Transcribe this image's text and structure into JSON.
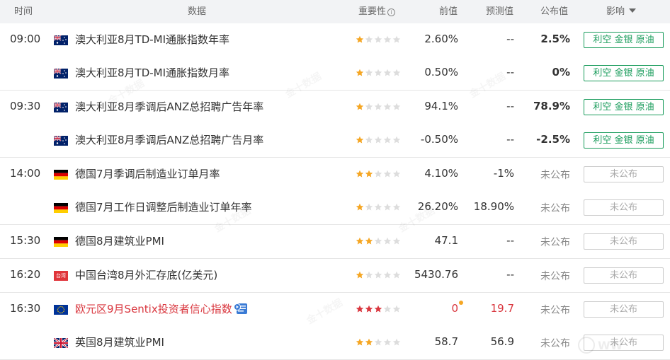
{
  "header": {
    "time": "时间",
    "data": "数据",
    "importance": "重要性",
    "info_icon": "i",
    "previous": "前值",
    "forecast": "预测值",
    "actual": "公布值",
    "effect": "影响"
  },
  "colors": {
    "star_on": "#f5a623",
    "star_red": "#d9363e",
    "star_off": "#dddddd",
    "effect_green": "#1a9c5c",
    "highlight_red": "#d9363e"
  },
  "groups": [
    {
      "time": "09:00",
      "rows": [
        {
          "flag": "australia-flag",
          "name": "澳大利亚8月TD-MI通胀指数年率",
          "stars": 1,
          "previous": "2.60%",
          "forecast": "--",
          "actual": "2.5%",
          "effect": "利空 金银 原油"
        },
        {
          "flag": "australia-flag",
          "name": "澳大利亚8月TD-MI通胀指数月率",
          "stars": 1,
          "previous": "0.50%",
          "forecast": "--",
          "actual": "0%",
          "effect": "利空 金银 原油"
        }
      ]
    },
    {
      "time": "09:30",
      "rows": [
        {
          "flag": "australia-flag",
          "name": "澳大利亚8月季调后ANZ总招聘广告年率",
          "stars": 1,
          "previous": "94.1%",
          "forecast": "--",
          "actual": "78.9%",
          "effect": "利空 金银 原油"
        },
        {
          "flag": "australia-flag",
          "name": "澳大利亚8月季调后ANZ总招聘广告月率",
          "stars": 1,
          "previous": "-0.50%",
          "forecast": "--",
          "actual": "-2.5%",
          "effect": "利空 金银 原油"
        }
      ]
    },
    {
      "time": "14:00",
      "rows": [
        {
          "flag": "germany-flag",
          "name": "德国7月季调后制造业订单月率",
          "stars": 2,
          "previous": "4.10%",
          "forecast": "-1%",
          "actual": "未公布",
          "effect": "未公布"
        },
        {
          "flag": "germany-flag",
          "name": "德国7月工作日调整后制造业订单年率",
          "stars": 1,
          "previous": "26.20%",
          "forecast": "18.90%",
          "actual": "未公布",
          "effect": "未公布"
        }
      ]
    },
    {
      "time": "15:30",
      "rows": [
        {
          "flag": "germany-flag",
          "name": "德国8月建筑业PMI",
          "stars": 2,
          "previous": "47.1",
          "forecast": "--",
          "actual": "未公布",
          "effect": "未公布"
        }
      ]
    },
    {
      "time": "16:20",
      "rows": [
        {
          "flag": "taiwan-flag",
          "flag_text": "台湾",
          "name": "中国台湾8月外汇存底(亿美元)",
          "stars": 1,
          "previous": "5430.76",
          "forecast": "--",
          "actual": "未公布",
          "effect": "未公布"
        }
      ]
    },
    {
      "time": "16:30",
      "rows": [
        {
          "flag": "eu-flag",
          "name": "欧元区9月Sentix投资者信心指数",
          "stars": 3,
          "previous": "0",
          "forecast": "19.7",
          "actual": "未公布",
          "effect": "未公布",
          "highlight": true
        },
        {
          "flag": "uk-flag",
          "name": "英国8月建筑业PMI",
          "stars": 2,
          "previous": "58.7",
          "forecast": "56.9",
          "actual": "未公布",
          "effect": "未公布"
        }
      ]
    }
  ]
}
